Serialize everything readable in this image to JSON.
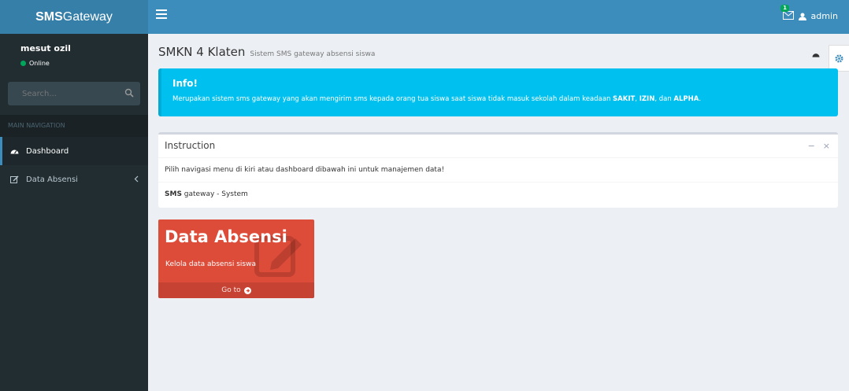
{
  "header": {
    "logo_bold": "SMS",
    "logo_rest": "Gateway",
    "mail_badge": "1",
    "user_name": "admin"
  },
  "sidebar": {
    "user": {
      "name": "mesut ozil",
      "status": "Online"
    },
    "search_placeholder": "Search...",
    "nav_header": "MAIN NAVIGATION",
    "items": [
      {
        "label": "Dashboard",
        "icon": "dashboard-icon",
        "active": true
      },
      {
        "label": "Data Absensi",
        "icon": "edit-icon",
        "active": false
      }
    ]
  },
  "content": {
    "title": "SMKN 4 Klaten",
    "subtitle": "Sistem SMS gateway absensi siswa",
    "callout": {
      "title": "Info!",
      "text_pre": "Merupakan sistem sms gateway yang akan mengirim sms kepada orang tua siswa saat siswa tidak masuk sekolah dalam keadaan ",
      "k1": "SAKIT",
      "sep1": ", ",
      "k2": "IZIN",
      "sep2": ", dan ",
      "k3": "ALPHA",
      "text_post": "."
    },
    "box": {
      "title": "Instruction",
      "body": "Pilih navigasi menu di kiri atau dashboard dibawah ini untuk manajemen data!",
      "footer_bold": "SMS",
      "footer_rest": " gateway - System"
    },
    "tile": {
      "title": "Data Absensi",
      "desc": "Kelola data absensi siswa",
      "footer": "Go to"
    }
  },
  "colors": {
    "header": "#3c8dbc",
    "logo": "#367fa9",
    "sidebar": "#222d32",
    "callout": "#00c0ef",
    "tile": "#dd4b39"
  }
}
